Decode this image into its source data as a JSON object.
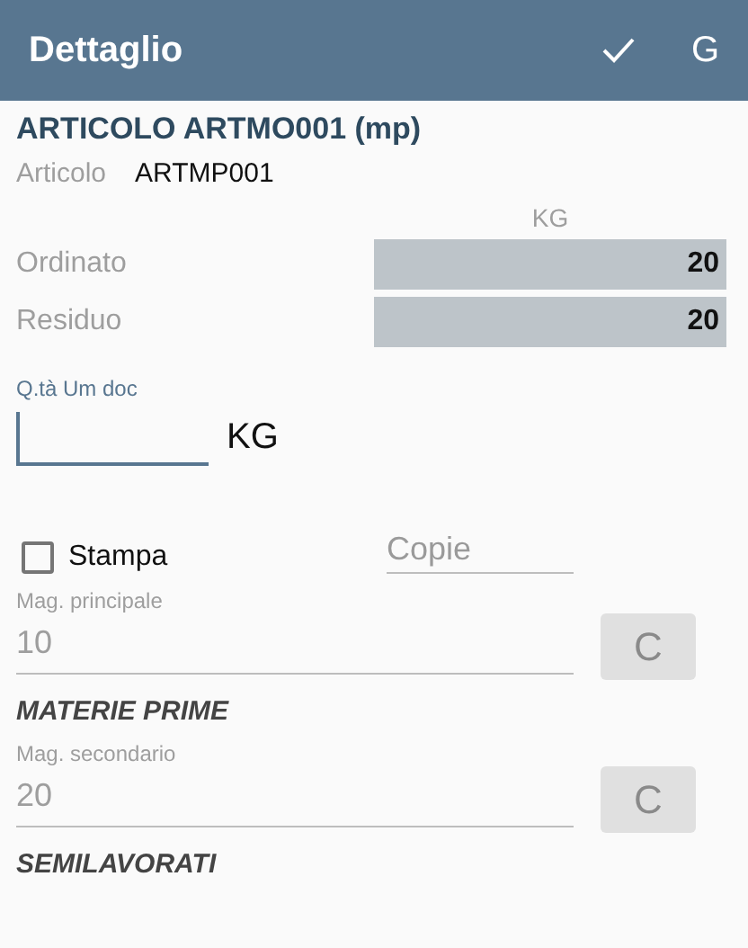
{
  "app_bar": {
    "title": "Dettaglio",
    "actions": [
      {
        "kind": "check"
      },
      {
        "kind": "text",
        "label": "G"
      }
    ]
  },
  "heading": "ARTICOLO ARTMO001 (mp)",
  "article": {
    "label": "Articolo",
    "value": "ARTMP001"
  },
  "quantities": {
    "unit": "KG",
    "rows": [
      {
        "label": "Ordinato",
        "value": "20"
      },
      {
        "label": "Residuo",
        "value": "20"
      }
    ]
  },
  "quantity_field": {
    "label": "Q.tà Um doc",
    "focused": true,
    "unit": "KG"
  },
  "print": {
    "label": "Stampa",
    "checked": false
  },
  "copies_field": {
    "placeholder": "Copie"
  },
  "warehouses": [
    {
      "label": "Mag. principale",
      "value": "10",
      "button": "C",
      "disabled": true,
      "section": "MATERIE PRIME"
    },
    {
      "label": "Mag. secondario",
      "value": "20",
      "button": "C",
      "disabled": true,
      "section": "SEMILAVORATI"
    }
  ]
}
